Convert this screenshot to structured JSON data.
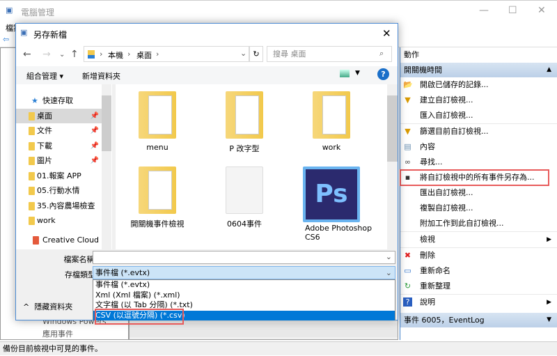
{
  "main_window": {
    "title": "電腦管理",
    "menu_file": "檔案",
    "status": "備份目前檢視中可見的事件。",
    "tree_partial": [
      "Windows Powers",
      "應用事件"
    ]
  },
  "actions_pane": {
    "header": "動作",
    "section1": "開關機時間",
    "items": [
      {
        "label": "開啟已儲存的記錄...",
        "icon": "folder-open-icon"
      },
      {
        "label": "建立自訂檢視...",
        "icon": "filter-icon"
      },
      {
        "label": "匯入自訂檢視...",
        "icon": ""
      },
      {
        "label": "篩選目前自訂檢視...",
        "icon": "filter-icon"
      },
      {
        "label": "內容",
        "icon": "properties-icon"
      },
      {
        "label": "尋找...",
        "icon": "binoculars-icon"
      },
      {
        "label": "將自訂檢視中的所有事件另存為...",
        "icon": "save-icon"
      },
      {
        "label": "匯出自訂檢視...",
        "icon": ""
      },
      {
        "label": "複製自訂檢視...",
        "icon": ""
      },
      {
        "label": "附加工作到此自訂檢視...",
        "icon": ""
      },
      {
        "label": "檢視",
        "icon": "",
        "submenu": true
      },
      {
        "label": "刪除",
        "icon": "delete-icon"
      },
      {
        "label": "重新命名",
        "icon": "rename-icon"
      },
      {
        "label": "重新整理",
        "icon": "refresh-icon"
      },
      {
        "label": "說明",
        "icon": "help-icon",
        "submenu": true
      }
    ],
    "section2": "事件 6005，EventLog"
  },
  "dialog": {
    "title": "另存新檔",
    "breadcrumb": [
      "本機",
      "桌面"
    ],
    "search_placeholder": "搜尋 桌面",
    "organize": "組合管理",
    "new_folder": "新增資料夾",
    "nav": {
      "quick_access": "快速存取",
      "items": [
        {
          "label": "桌面",
          "pinned": true,
          "selected": true
        },
        {
          "label": "文件",
          "pinned": true
        },
        {
          "label": "下載",
          "pinned": true
        },
        {
          "label": "圖片",
          "pinned": true
        },
        {
          "label": "01.報案 APP"
        },
        {
          "label": "05.行動水情"
        },
        {
          "label": "35.內容農場檢查"
        },
        {
          "label": "work"
        }
      ],
      "creative_cloud": "Creative Cloud Files"
    },
    "files": [
      "menu",
      "P 改字型",
      "work",
      "開關機事件檢視",
      "0604事件",
      "Adobe Photoshop CS6"
    ],
    "filename_label": "檔案名稱(N):",
    "filename_value": "",
    "filetype_label": "存檔類型(T):",
    "filetype_value": "事件檔 (*.evtx)",
    "filetype_options": [
      "事件檔 (*.evtx)",
      "Xml (Xml 檔案) (*.xml)",
      "文字檔 (以 Tab 分隔) (*.txt)",
      "CSV (以逗號分隔) (*.csv)"
    ],
    "hide_folders": "隱藏資料夾",
    "accent": "#0078d7",
    "highlight": "#e85a5a"
  }
}
